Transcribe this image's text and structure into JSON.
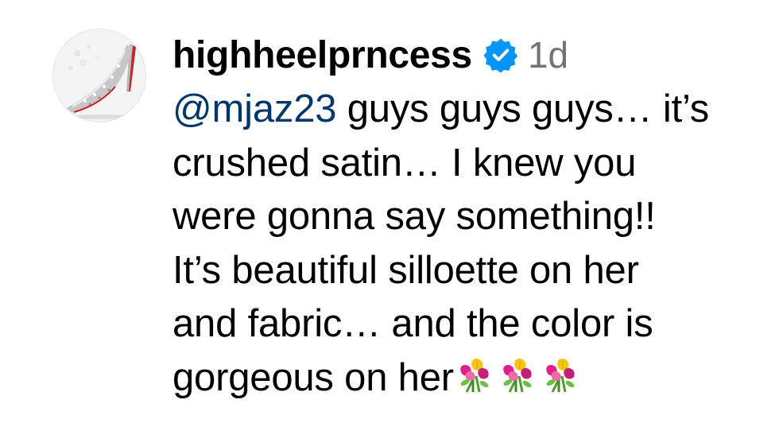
{
  "comment": {
    "avatar_icon": "high-heel-shoe-avatar",
    "username": "highheelprncess",
    "verified_icon": "verified-badge-icon",
    "verified_color": "#0095f6",
    "time": "1d",
    "mention": "@mjaz23",
    "text_lines": [
      " guys guys guys… it’s",
      "crushed satin… I knew you",
      "were gonna say something!!",
      "It’s beautiful silloette on her",
      "and fabric… and the color is",
      "gorgeous on her"
    ],
    "emoji": [
      "bouquet-emoji",
      "bouquet-emoji",
      "bouquet-emoji"
    ],
    "colors": {
      "text": "#000000",
      "mention": "#00376b",
      "timestamp": "#737373"
    }
  }
}
